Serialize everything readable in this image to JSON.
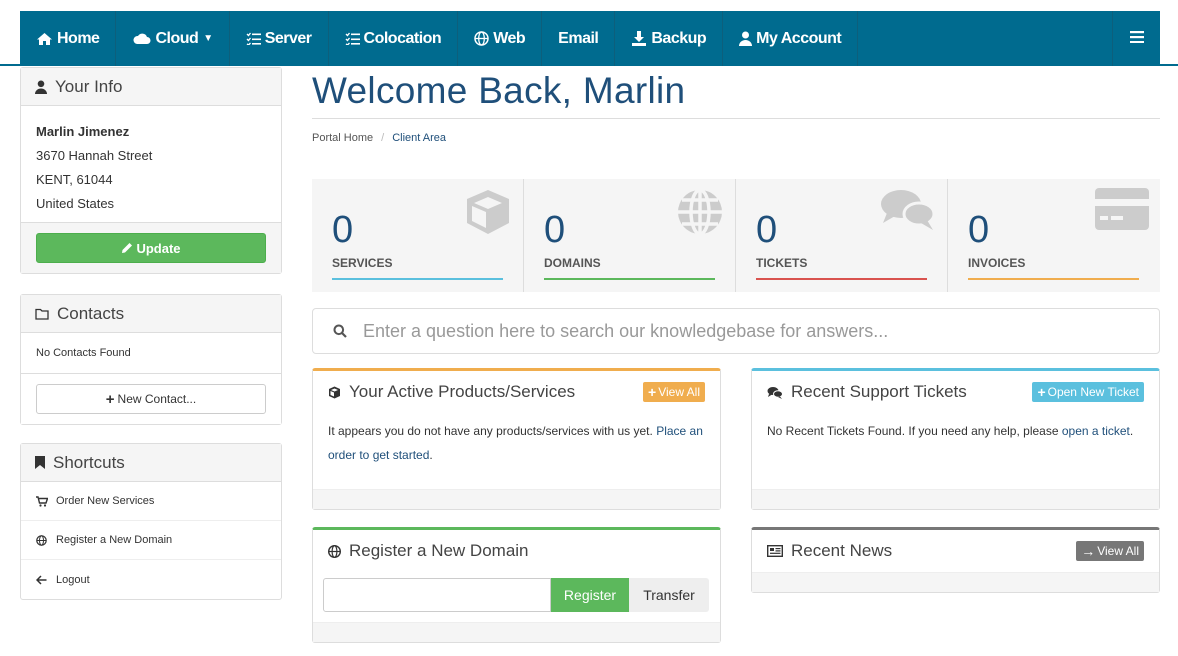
{
  "nav": {
    "items": [
      {
        "label": "Home",
        "icon": "home-icon"
      },
      {
        "label": "Cloud",
        "icon": "cloud-icon",
        "has_caret": true
      },
      {
        "label": "Server",
        "icon": "list-icon"
      },
      {
        "label": "Colocation",
        "icon": "list-icon"
      },
      {
        "label": "Web",
        "icon": "globe-icon"
      },
      {
        "label": "Email",
        "icon": ""
      },
      {
        "label": "Backup",
        "icon": "download-icon"
      },
      {
        "label": "My Account",
        "icon": "user-icon"
      }
    ],
    "menu_icon": "hamburger-icon"
  },
  "sidebar": {
    "your_info": {
      "title": "Your Info",
      "name": "Marlin Jimenez",
      "street": "3670 Hannah Street",
      "city": "KENT, 61044",
      "country": "United States",
      "update_label": "Update"
    },
    "contacts": {
      "title": "Contacts",
      "empty_text": "No Contacts Found",
      "new_contact_label": "New Contact..."
    },
    "shortcuts": {
      "title": "Shortcuts",
      "items": [
        {
          "label": "Order New Services",
          "icon": "cart-icon"
        },
        {
          "label": "Register a New Domain",
          "icon": "globe-icon"
        },
        {
          "label": "Logout",
          "icon": "arrow-left-icon"
        }
      ]
    }
  },
  "main": {
    "title": "Welcome Back, Marlin",
    "breadcrumb": {
      "home": "Portal Home",
      "separator": "/",
      "current": "Client Area"
    },
    "tiles": [
      {
        "count": "0",
        "label": "SERVICES",
        "color": "#5bc0de",
        "icon": "cube-icon"
      },
      {
        "count": "0",
        "label": "DOMAINS",
        "color": "#5cb85c",
        "icon": "globe-icon"
      },
      {
        "count": "0",
        "label": "TICKETS",
        "color": "#d9534f",
        "icon": "comments-icon"
      },
      {
        "count": "0",
        "label": "INVOICES",
        "color": "#f0ad4e",
        "icon": "credit-card-icon"
      }
    ],
    "kb_search": {
      "placeholder": "Enter a question here to search our knowledgebase for answers..."
    },
    "products": {
      "title": "Your Active Products/Services",
      "button": "View All",
      "text": "It appears you do not have any products/services with us yet. ",
      "link": "Place an order to get started",
      "trail": ".",
      "accent": "#f0ad4e"
    },
    "tickets": {
      "title": "Recent Support Tickets",
      "button": "Open New Ticket",
      "text": "No Recent Tickets Found. If you need any help, please ",
      "link": "open a ticket",
      "trail": ".",
      "accent": "#5bc0de"
    },
    "register_domain": {
      "title": "Register a New Domain",
      "register_label": "Register",
      "transfer_label": "Transfer",
      "accent": "#5cb85c"
    },
    "news": {
      "title": "Recent News",
      "button": "View All",
      "accent": "#777777"
    }
  }
}
